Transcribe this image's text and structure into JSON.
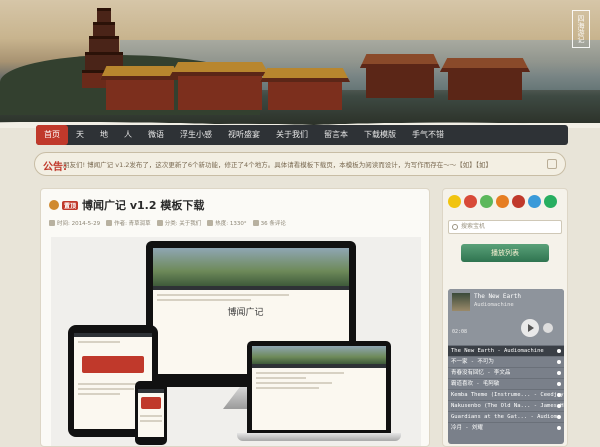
{
  "banner": {
    "seal_text": "四海游记"
  },
  "nav": {
    "items": [
      {
        "label": "首页",
        "active": true
      },
      {
        "label": "天"
      },
      {
        "label": "地"
      },
      {
        "label": "人"
      },
      {
        "label": "微语"
      },
      {
        "label": "浮生小感"
      },
      {
        "label": "视听盛宴"
      },
      {
        "label": "关于我们"
      },
      {
        "label": "留言本"
      },
      {
        "label": "下载模版"
      },
      {
        "label": "手气不错"
      }
    ]
  },
  "notice": {
    "tag": "公告:",
    "text": "朋友们! 博闻广记 v1.2发布了，这次更新了6个新功能，修正了4个地方。具体请看模板下载页，本模板为阅读而设计，为写作而存在～～【如】【如】"
  },
  "article": {
    "badge": "置顶",
    "title": "博闻广记 v1.2 模板下载",
    "meta": {
      "date": "时间: 2014-5-29",
      "author": "作者: 青草润草",
      "category": "分类: 关于我们",
      "views": "热度: 1330°",
      "comments": "36 条评论"
    },
    "mockup_text": "博闻广记"
  },
  "sidebar": {
    "social_icons": [
      {
        "name": "qq-icon",
        "color": "#f1c40f"
      },
      {
        "name": "gmail-icon",
        "color": "#d84a38"
      },
      {
        "name": "wechat-icon",
        "color": "#5cb85c"
      },
      {
        "name": "rss-icon",
        "color": "#e67e22"
      },
      {
        "name": "user-icon",
        "color": "#c0392b"
      },
      {
        "name": "weibo-icon",
        "color": "#3a9ad9"
      },
      {
        "name": "chat-icon",
        "color": "#27ae60"
      }
    ],
    "search_placeholder": "搜索宝机",
    "ribbon_label": "播放列表",
    "player": {
      "song": "The New Earth",
      "artist": "Audiomachine",
      "time": "02:08",
      "tracks": [
        {
          "title": "The New Earth - Audiomachine",
          "selected": true
        },
        {
          "title": "不一家 - 不可为"
        },
        {
          "title": "青春没有回忆 - 李文品"
        },
        {
          "title": "霸道喜欢 - 毛阿敏"
        },
        {
          "title": "Kemba Theme (Instrume... - Ceedjay"
        },
        {
          "title": "Nakusenbo (The Old Na... - James H"
        },
        {
          "title": "Guardians at the Gat... - Audioma"
        },
        {
          "title": "冷月 - 刘耀"
        }
      ]
    }
  }
}
